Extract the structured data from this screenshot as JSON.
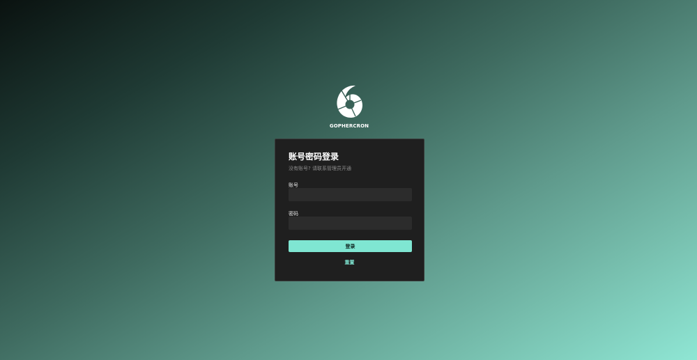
{
  "brand": {
    "name": "GOPHERCRON",
    "logo_icon": "aperture-swirl-icon"
  },
  "login": {
    "title": "账号密码登录",
    "subtitle": "没有账号? 请联系管理员开通",
    "account_label": "账号",
    "account_value": "",
    "password_label": "密码",
    "password_value": "",
    "submit_label": "登录",
    "reset_label": "重置"
  },
  "colors": {
    "accent": "#7fe6d2",
    "card_bg": "#1f1f1f",
    "input_bg": "#2c2c2c"
  }
}
